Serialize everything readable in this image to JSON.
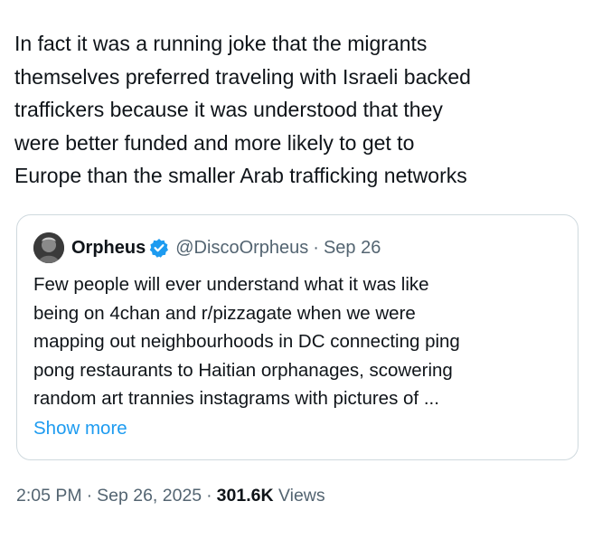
{
  "tweet": {
    "text": "In fact it was a running joke that the migrants\nthemselves preferred traveling with Israeli backed\ntraffickers because it was understood that they\nwere better funded and more likely to get to\nEurope than the smaller Arab trafficking networks",
    "time": "2:05 PM",
    "date": "Sep 26, 2025",
    "views_count": "301.6K",
    "views_label": "Views"
  },
  "quote": {
    "author_name": "Orpheus",
    "handle": "@DiscoOrpheus",
    "separator": "·",
    "date": "Sep 26",
    "text": "Few people will ever understand what it was like\nbeing on 4chan and r/pizzagate when we were\nmapping out neighbourhoods in DC connecting ping\npong restaurants to Haitian orphanages, scowering\nrandom art trannies instagrams with pictures of ...",
    "show_more": "Show more",
    "verified_icon": "verified-badge-icon",
    "avatar_icon": "avatar"
  },
  "meta": {
    "separator": "·"
  },
  "colors": {
    "text": "#0f1419",
    "secondary": "#536471",
    "link": "#1d9bf0",
    "border": "#cfd9de",
    "verified": "#1d9bf0"
  }
}
